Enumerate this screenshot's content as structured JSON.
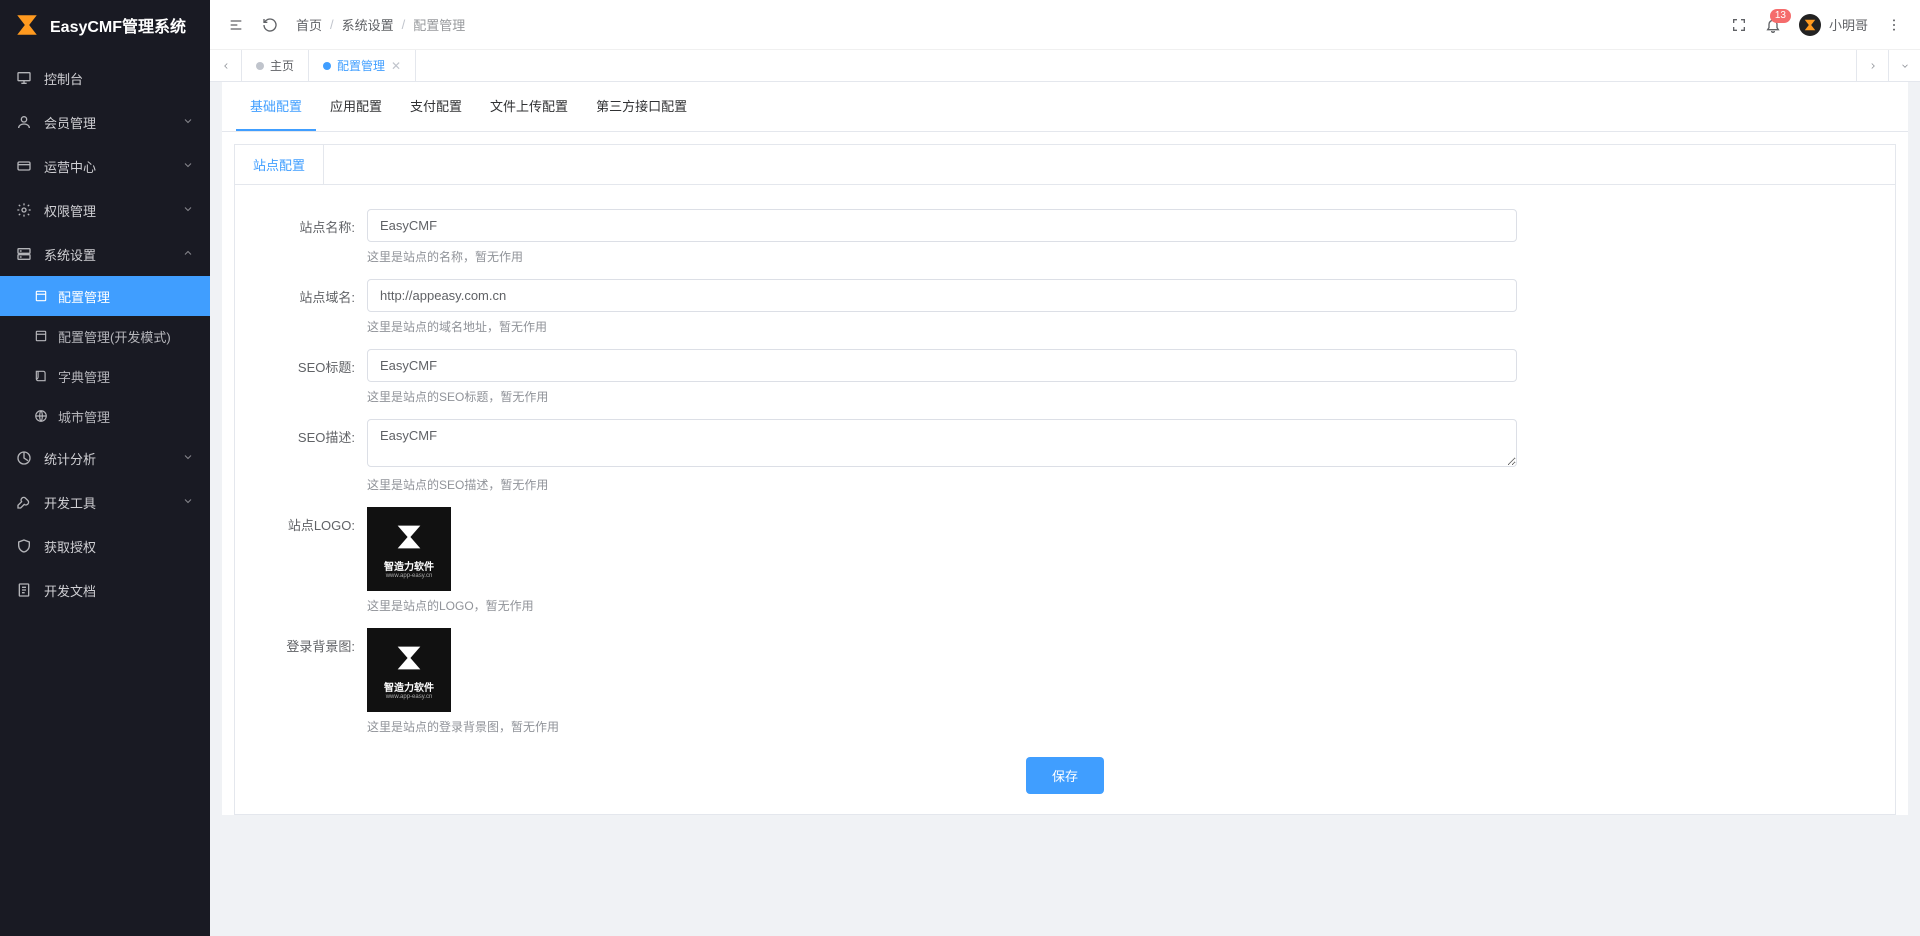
{
  "brand": {
    "name": "EasyCMF管理系统"
  },
  "sidebar": {
    "items": [
      {
        "label": "控制台",
        "icon": "monitor",
        "expandable": false
      },
      {
        "label": "会员管理",
        "icon": "user",
        "expandable": true
      },
      {
        "label": "运营中心",
        "icon": "card",
        "expandable": true
      },
      {
        "label": "权限管理",
        "icon": "gear",
        "expandable": true
      },
      {
        "label": "系统设置",
        "icon": "server",
        "expandable": true,
        "expanded": true
      },
      {
        "label": "统计分析",
        "icon": "chart",
        "expandable": true
      },
      {
        "label": "开发工具",
        "icon": "tool",
        "expandable": true
      },
      {
        "label": "获取授权",
        "icon": "shield",
        "expandable": false
      },
      {
        "label": "开发文档",
        "icon": "doc",
        "expandable": false
      }
    ],
    "submenu": [
      {
        "label": "配置管理",
        "active": true
      },
      {
        "label": "配置管理(开发模式)",
        "active": false
      },
      {
        "label": "字典管理",
        "active": false
      },
      {
        "label": "城市管理",
        "active": false
      }
    ]
  },
  "breadcrumb": {
    "items": [
      "首页",
      "系统设置",
      "配置管理"
    ]
  },
  "topbar": {
    "badge": "13",
    "username": "小明哥"
  },
  "pagetabs": [
    {
      "label": "主页",
      "active": false,
      "closable": false
    },
    {
      "label": "配置管理",
      "active": true,
      "closable": true
    }
  ],
  "configTabs": [
    "基础配置",
    "应用配置",
    "支付配置",
    "文件上传配置",
    "第三方接口配置"
  ],
  "configTabActive": 0,
  "cardTab": "站点配置",
  "form": {
    "fields": [
      {
        "label": "站点名称:",
        "value": "EasyCMF",
        "help": "这里是站点的名称，暂无作用",
        "type": "text"
      },
      {
        "label": "站点域名:",
        "value": "http://appeasy.com.cn",
        "help": "这里是站点的域名地址，暂无作用",
        "type": "text"
      },
      {
        "label": "SEO标题:",
        "value": "EasyCMF",
        "help": "这里是站点的SEO标题，暂无作用",
        "type": "text"
      },
      {
        "label": "SEO描述:",
        "value": "EasyCMF",
        "help": "这里是站点的SEO描述，暂无作用",
        "type": "textarea"
      },
      {
        "label": "站点LOGO:",
        "help": "这里是站点的LOGO，暂无作用",
        "type": "image",
        "imgText": "智造力软件",
        "imgSub": "www.app-easy.cn"
      },
      {
        "label": "登录背景图:",
        "help": "这里是站点的登录背景图，暂无作用",
        "type": "image",
        "imgText": "智造力软件",
        "imgSub": "www.app-easy.cn"
      }
    ],
    "submit": "保存"
  }
}
